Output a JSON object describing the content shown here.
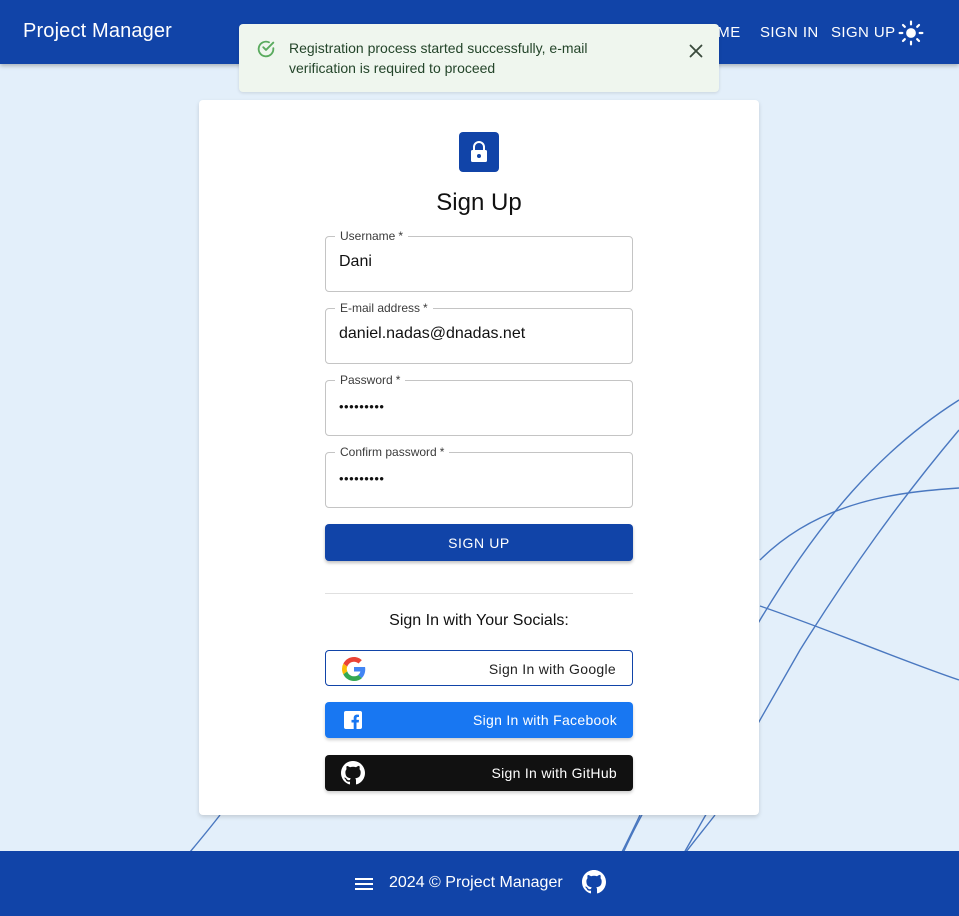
{
  "header": {
    "brand": "Project Manager",
    "nav_home": "HOME",
    "nav_signin": "SIGN IN",
    "nav_signup": "SIGN UP",
    "theme_icon": "sun-icon"
  },
  "toast": {
    "message": "Registration process started successfully, e-mail verification is required to proceed",
    "icon": "check-circle-icon"
  },
  "form": {
    "title": "Sign Up",
    "username_label": "Username",
    "username_value": "Dani",
    "email_label": "E-mail address",
    "email_value": "daniel.nadas@dnadas.net",
    "password_label": "Password",
    "password_value": "password1",
    "confirm_label": "Confirm password",
    "confirm_value": "password1",
    "required_mark": "*",
    "submit_label": "SIGN UP"
  },
  "socials": {
    "title": "Sign In with Your Socials:",
    "google": "Sign In with Google",
    "facebook": "Sign In with Facebook",
    "github": "Sign In with GitHub"
  },
  "footer": {
    "copyright": "2024 © Project Manager"
  },
  "colors": {
    "primary": "#1144a8",
    "background": "#e3effa",
    "facebook": "#1877f2",
    "github": "#111111",
    "toast_bg": "#eff6ee",
    "toast_icon": "#5aab5e"
  }
}
